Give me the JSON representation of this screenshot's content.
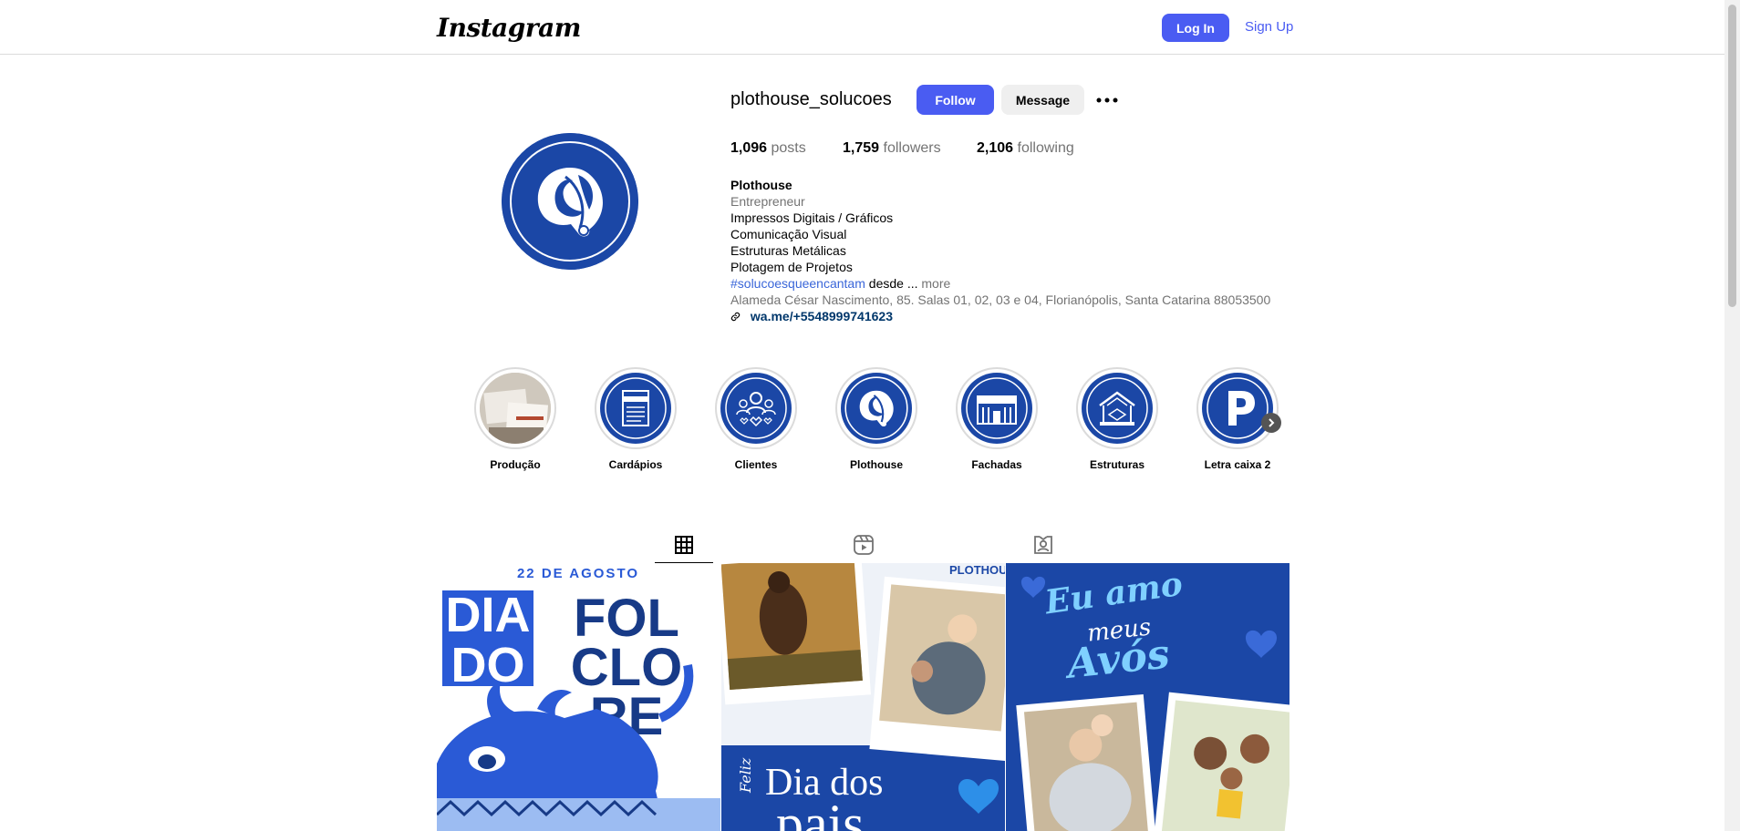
{
  "header": {
    "logo_text": "Instagram",
    "login_label": "Log In",
    "signup_label": "Sign Up"
  },
  "profile": {
    "username": "plothouse_solucoes",
    "follow_label": "Follow",
    "message_label": "Message",
    "more_icon": "more-horizontal-icon",
    "stats": {
      "posts_count": "1,096",
      "posts_label": "posts",
      "followers_count": "1,759",
      "followers_label": "followers",
      "following_count": "2,106",
      "following_label": "following"
    },
    "bio": {
      "name": "Plothouse",
      "category": "Entrepreneur",
      "lines": [
        "Impressos Digitais / Gráficos",
        "Comunicação Visual",
        "Estruturas Metálicas",
        "Plotagem de Projetos"
      ],
      "emoji": "",
      "hashtag": "#solucoesqueencantam",
      "hashtag_suffix": "desde ...",
      "more_label": "more",
      "address": "Alameda César Nascimento, 85. Salas 01, 02, 03 e 04, Florianópolis, Santa Catarina 88053500",
      "link": "wa.me/+5548999741623"
    }
  },
  "highlights": [
    {
      "label": "Produção",
      "icon": "production-photo"
    },
    {
      "label": "Cardápios",
      "icon": "menu-card-icon"
    },
    {
      "label": "Clientes",
      "icon": "clients-icon"
    },
    {
      "label": "Plothouse",
      "icon": "plothouse-logo"
    },
    {
      "label": "Fachadas",
      "icon": "storefront-icon"
    },
    {
      "label": "Estruturas",
      "icon": "structure-icon"
    },
    {
      "label": "Letra caixa 2",
      "icon": "letter-p-icon"
    }
  ],
  "tabs": [
    {
      "name": "posts",
      "icon": "grid-icon",
      "active": true
    },
    {
      "name": "reels",
      "icon": "reels-icon",
      "active": false
    },
    {
      "name": "tagged",
      "icon": "tagged-user-icon",
      "active": false
    }
  ],
  "posts": [
    {
      "date_label": "22 DE AGOSTO",
      "words": [
        "DIA",
        "DO",
        "FOL",
        "CLO",
        "RE"
      ]
    },
    {
      "brand_label": "PLOTHOUS",
      "script_label": "Feliz",
      "title_label": "Dia dos",
      "title_cut": "pais"
    },
    {
      "script_line1": "Eu amo",
      "script_line2": "meus",
      "script_line3": "Avós"
    }
  ],
  "colors": {
    "accent": "#4a5cf2",
    "brand_blue": "#1b47a6",
    "link_dark": "#00376b",
    "muted": "#737373"
  }
}
